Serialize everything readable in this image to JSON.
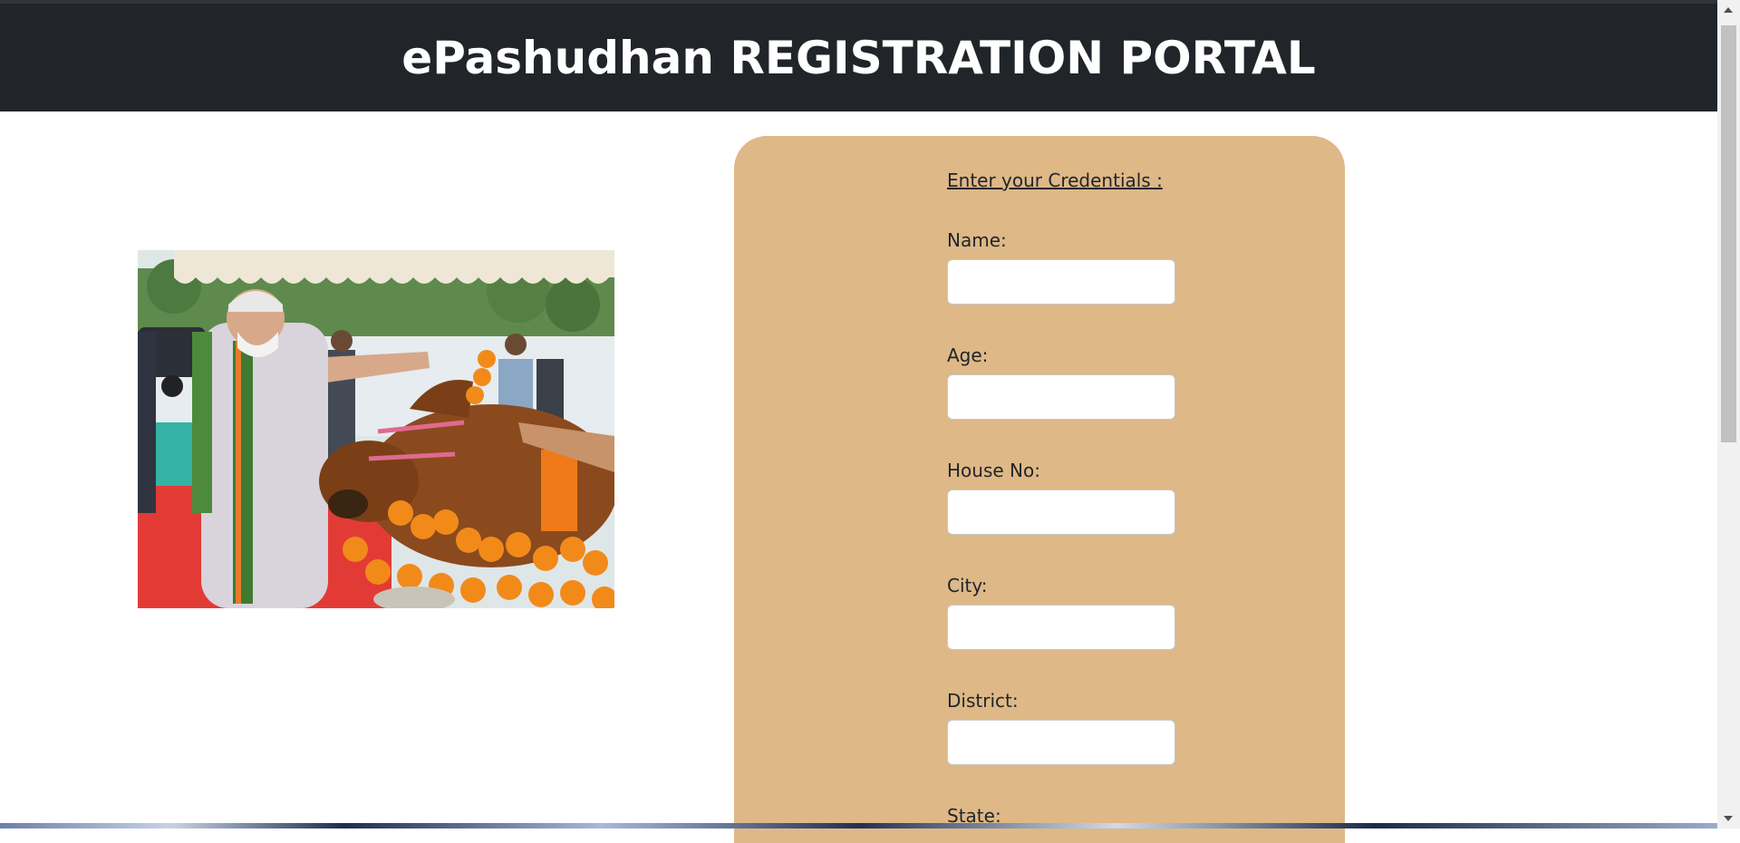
{
  "header": {
    "title": "ePashudhan REGISTRATION PORTAL"
  },
  "photo": {
    "icon": "photo-image"
  },
  "form": {
    "heading": "Enter your Credentials :",
    "fields": [
      {
        "label": "Name:",
        "value": "",
        "placeholder": ""
      },
      {
        "label": "Age:",
        "value": "",
        "placeholder": ""
      },
      {
        "label": "House No:",
        "value": "",
        "placeholder": ""
      },
      {
        "label": "City:",
        "value": "",
        "placeholder": ""
      },
      {
        "label": "District:",
        "value": "",
        "placeholder": ""
      },
      {
        "label": "State:",
        "value": "",
        "placeholder": ""
      }
    ]
  },
  "colors": {
    "header_bg": "#212529",
    "card_bg": "#deb887",
    "text": "#212529"
  }
}
